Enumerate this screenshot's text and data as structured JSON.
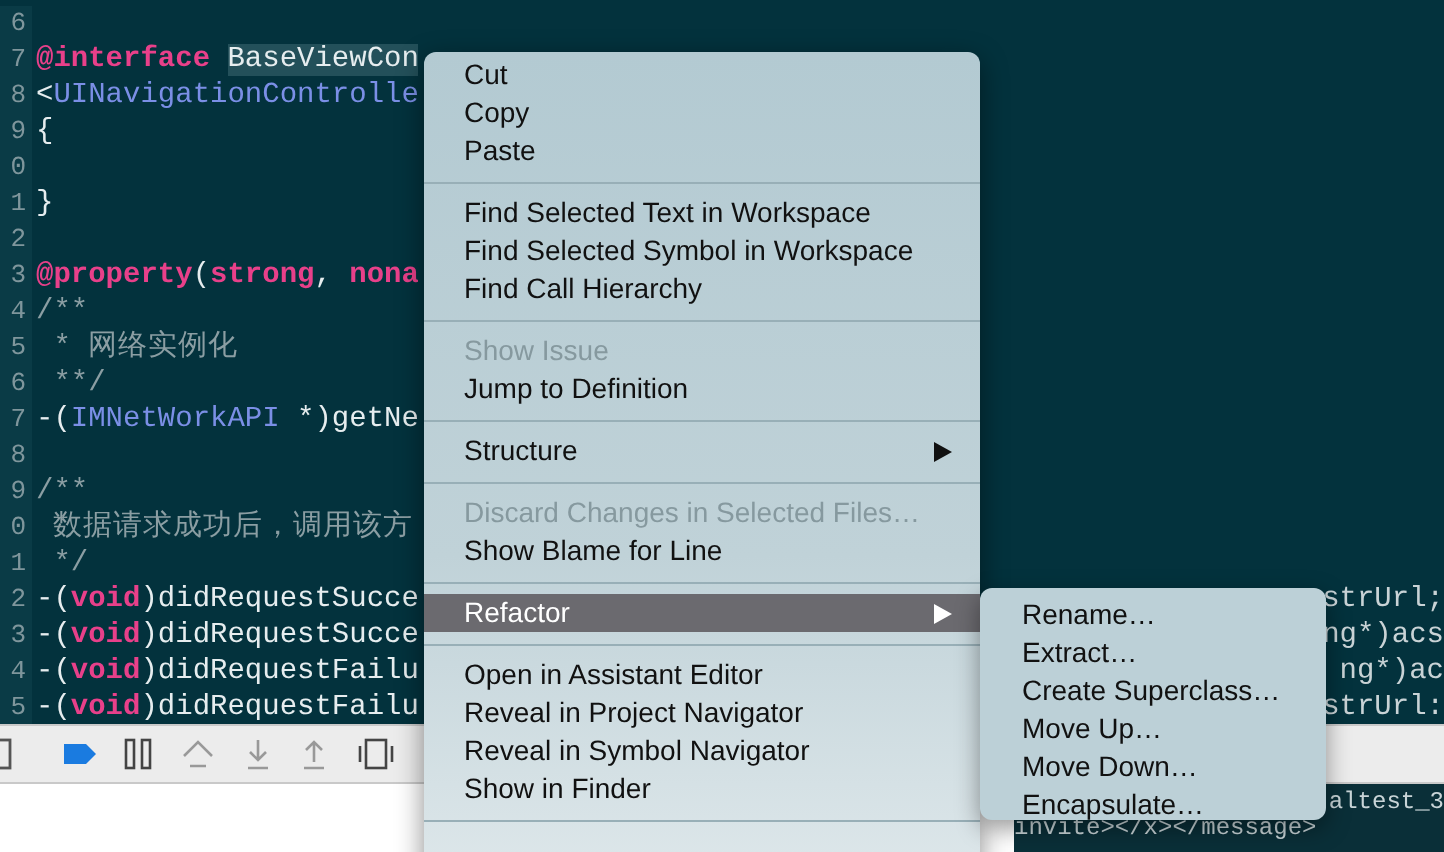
{
  "editor": {
    "lines": [
      {
        "number": "6"
      },
      {
        "number": "7",
        "segments": [
          {
            "kind": "keyword",
            "text": "@interface "
          },
          {
            "kind": "selected",
            "text": "BaseViewCon"
          }
        ]
      },
      {
        "number": "8",
        "segments": [
          {
            "kind": "plain",
            "text": "<"
          },
          {
            "kind": "type",
            "text": "UINavigationControlle"
          }
        ]
      },
      {
        "number": "9",
        "segments": [
          {
            "kind": "plain",
            "text": "{"
          }
        ]
      },
      {
        "number": "0"
      },
      {
        "number": "1",
        "segments": [
          {
            "kind": "plain",
            "text": "}"
          }
        ]
      },
      {
        "number": "2"
      },
      {
        "number": "3",
        "segments": [
          {
            "kind": "keyword",
            "text": "@property"
          },
          {
            "kind": "plain",
            "text": "("
          },
          {
            "kind": "keyword",
            "text": "strong"
          },
          {
            "kind": "plain",
            "text": ", "
          },
          {
            "kind": "keyword",
            "text": "nona"
          }
        ]
      },
      {
        "number": "4",
        "segments": [
          {
            "kind": "comment",
            "text": "/**"
          }
        ]
      },
      {
        "number": "5",
        "segments": [
          {
            "kind": "comment",
            "text": " * 网络实例化"
          }
        ]
      },
      {
        "number": "6",
        "segments": [
          {
            "kind": "comment",
            "text": " **/"
          }
        ]
      },
      {
        "number": "7",
        "segments": [
          {
            "kind": "plain",
            "text": "-("
          },
          {
            "kind": "type",
            "text": "IMNetWorkAPI"
          },
          {
            "kind": "plain",
            "text": " *)getNe"
          }
        ]
      },
      {
        "number": "8"
      },
      {
        "number": "9",
        "segments": [
          {
            "kind": "comment",
            "text": "/**"
          }
        ]
      },
      {
        "number": "0",
        "segments": [
          {
            "kind": "comment",
            "text": " 数据请求成功后，调用该方"
          }
        ]
      },
      {
        "number": "1",
        "segments": [
          {
            "kind": "comment",
            "text": " */"
          }
        ]
      },
      {
        "number": "2",
        "segments": [
          {
            "kind": "plain",
            "text": "-("
          },
          {
            "kind": "keyword",
            "text": "void"
          },
          {
            "kind": "plain",
            "text": ")didRequestSucce"
          }
        ],
        "tail": "strUrl;"
      },
      {
        "number": "3",
        "segments": [
          {
            "kind": "plain",
            "text": "-("
          },
          {
            "kind": "keyword",
            "text": "void"
          },
          {
            "kind": "plain",
            "text": ")didRequestSucce"
          }
        ],
        "tail": "ng*)acs"
      },
      {
        "number": "4",
        "segments": [
          {
            "kind": "plain",
            "text": "-("
          },
          {
            "kind": "keyword",
            "text": "void"
          },
          {
            "kind": "plain",
            "text": ")didRequestFailu"
          }
        ],
        "tail": "ng*)ac"
      },
      {
        "number": "5",
        "segments": [
          {
            "kind": "plain",
            "text": "-("
          },
          {
            "kind": "keyword",
            "text": "void"
          },
          {
            "kind": "plain",
            "text": ")didRequestFailu"
          }
        ],
        "tail": "strUrl:"
      }
    ]
  },
  "console": {
    "lines": [
      "altest_3",
      "invite></x></message>"
    ]
  },
  "context_menu": {
    "groups": [
      [
        {
          "label": "Cut",
          "disabled": false,
          "selected": false
        },
        {
          "label": "Copy",
          "disabled": false,
          "selected": false
        },
        {
          "label": "Paste",
          "disabled": false,
          "selected": false
        }
      ],
      [
        {
          "label": "Find Selected Text in Workspace",
          "disabled": false,
          "selected": false
        },
        {
          "label": "Find Selected Symbol in Workspace",
          "disabled": false,
          "selected": false
        },
        {
          "label": "Find Call Hierarchy",
          "disabled": false,
          "selected": false
        }
      ],
      [
        {
          "label": "Show Issue",
          "disabled": true,
          "selected": false
        },
        {
          "label": "Jump to Definition",
          "disabled": false,
          "selected": false
        }
      ],
      [
        {
          "label": "Structure",
          "disabled": false,
          "selected": false,
          "submenu": true
        }
      ],
      [
        {
          "label": "Discard Changes in Selected Files…",
          "disabled": true,
          "selected": false
        },
        {
          "label": "Show Blame for Line",
          "disabled": false,
          "selected": false
        }
      ],
      [
        {
          "label": "Refactor",
          "disabled": false,
          "selected": true,
          "submenu": true
        }
      ],
      [
        {
          "label": "Open in Assistant Editor",
          "disabled": false,
          "selected": false
        },
        {
          "label": "Reveal in Project Navigator",
          "disabled": false,
          "selected": false
        },
        {
          "label": "Reveal in Symbol Navigator",
          "disabled": false,
          "selected": false
        },
        {
          "label": "Show in Finder",
          "disabled": false,
          "selected": false
        }
      ]
    ]
  },
  "submenu": {
    "items": [
      "Rename…",
      "Extract…",
      "Create Superclass…",
      "Move Up…",
      "Move Down…",
      "Encapsulate…"
    ]
  }
}
